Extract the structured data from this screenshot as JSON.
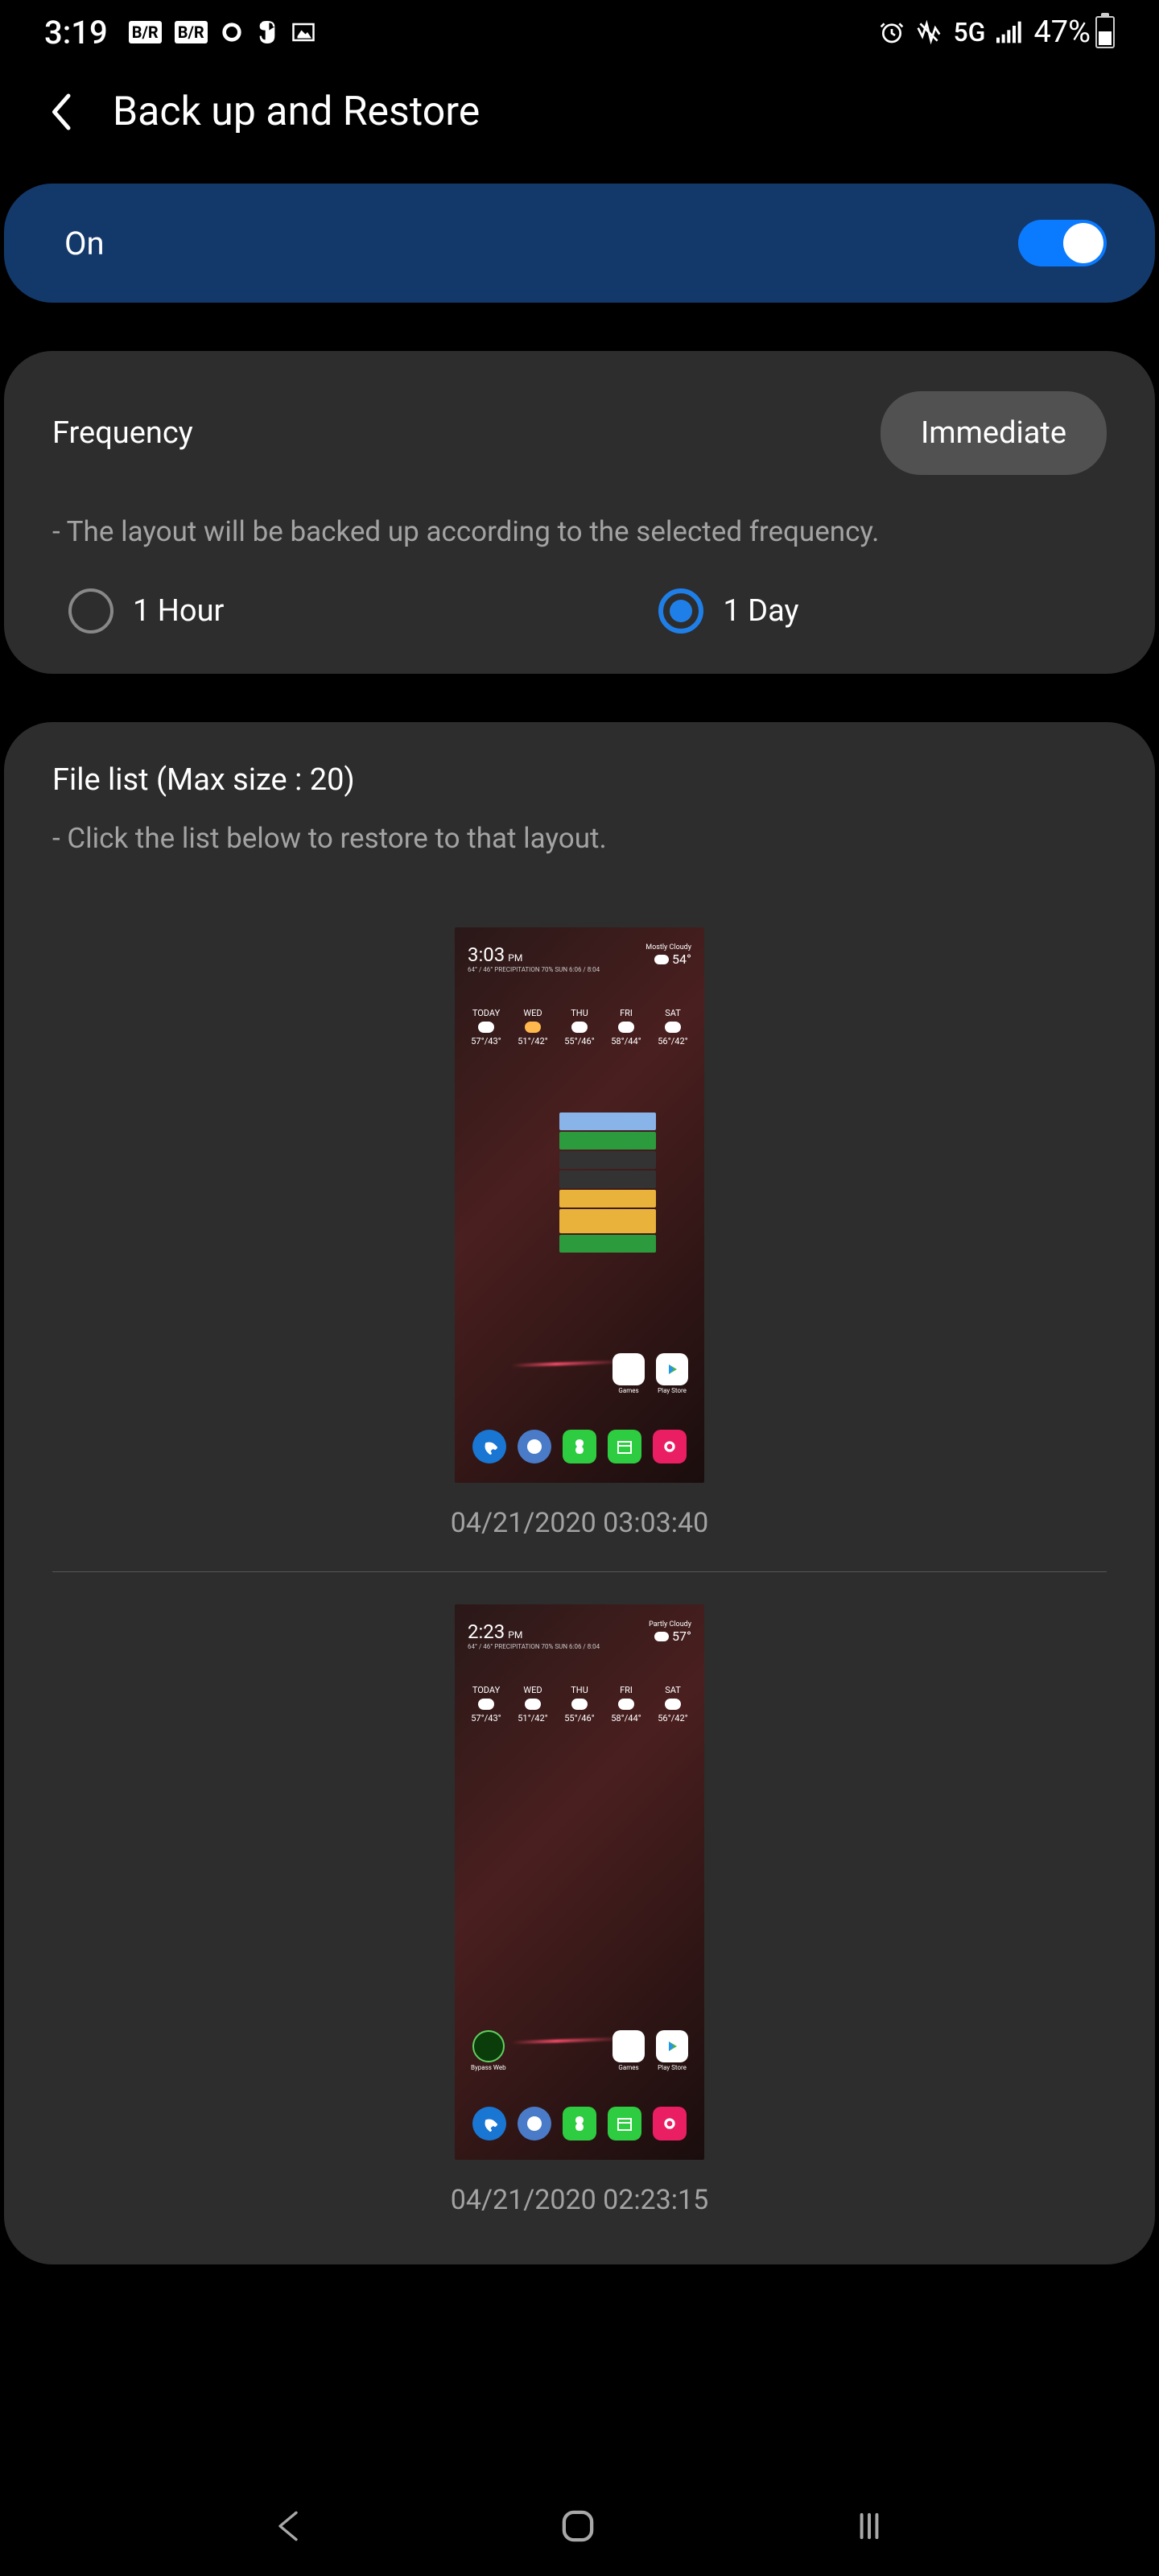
{
  "statusBar": {
    "time": "3:19",
    "badge1": "B/R",
    "badge2": "B/R",
    "network": "5G",
    "batteryPct": "47%"
  },
  "header": {
    "title": "Back up and Restore"
  },
  "toggle": {
    "label": "On",
    "state": true
  },
  "frequency": {
    "label": "Frequency",
    "button": "Immediate",
    "note": "- The layout will be backed up according to the selected frequency.",
    "options": [
      {
        "label": "1 Hour",
        "selected": false
      },
      {
        "label": "1 Day",
        "selected": true
      }
    ]
  },
  "fileList": {
    "title": "File list (Max size : 20)",
    "note": "- Click the list below to restore to that layout.",
    "items": [
      {
        "timestamp": "04/21/2020 03:03:40",
        "thumbTime": "3:03",
        "thumbTimeSuffix": "PM",
        "thumbCond": "Mostly Cloudy",
        "thumbTemp": "54°",
        "hasCalendar": true,
        "hasExtraApp": false
      },
      {
        "timestamp": "04/21/2020 02:23:15",
        "thumbTime": "2:23",
        "thumbTimeSuffix": "PM",
        "thumbCond": "Partly Cloudy",
        "thumbTemp": "57°",
        "hasCalendar": false,
        "hasExtraApp": true
      }
    ]
  }
}
